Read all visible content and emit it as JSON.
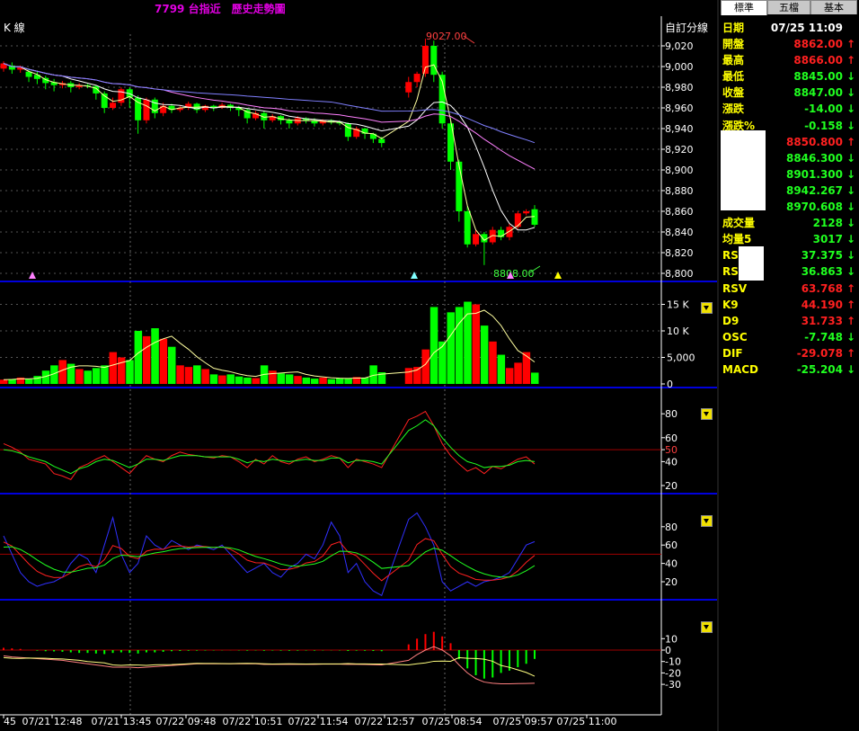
{
  "header": {
    "title": "7799 台指近　歷史走勢圖",
    "k_label": "K 線",
    "custom_label": "自訂分線"
  },
  "main_chart": {
    "y_ticks": [
      "9,020",
      "9,000",
      "8,980",
      "8,960",
      "8,940",
      "8,920",
      "8,900",
      "8,880",
      "8,860",
      "8,840",
      "8,820",
      "8,800"
    ],
    "high_label": "9027.00",
    "low_label": "8808.00"
  },
  "volume_chart": {
    "y_ticks": [
      "15 K",
      "10 K",
      "5,000",
      "0"
    ]
  },
  "rsi_chart": {
    "y_ticks": [
      "80",
      "60",
      "50",
      "40",
      "20"
    ]
  },
  "kd_chart": {
    "y_ticks": [
      "80",
      "60",
      "40",
      "20"
    ]
  },
  "macd_chart": {
    "y_ticks": [
      "10",
      "0",
      "-10",
      "-20",
      "-30"
    ]
  },
  "x_axis": {
    "labels": [
      "45",
      "07/21 12:48",
      "07/21 13:45",
      "07/22 09:48",
      "07/22 10:51",
      "07/22 11:54",
      "07/22 12:57",
      "07/25 08:54",
      "07/25 09:57",
      "07/25 11:00"
    ]
  },
  "colors": {
    "up": "#ff0000",
    "down": "#00ff00",
    "flat": "#ffffff",
    "label": "#ffff00",
    "axis_line": "#0000cc"
  },
  "panel": {
    "tabs": [
      "標準",
      "五檔",
      "基本"
    ],
    "rows": [
      {
        "label": "日期",
        "value": "07/25 11:09",
        "color": "#ffffff",
        "arrow": ""
      },
      {
        "label": "開盤",
        "value": "8862.00",
        "color": "#ff2020",
        "arrow": "↑"
      },
      {
        "label": "最高",
        "value": "8866.00",
        "color": "#ff2020",
        "arrow": "↑"
      },
      {
        "label": "最低",
        "value": "8845.00",
        "color": "#20ff20",
        "arrow": "↓"
      },
      {
        "label": "收盤",
        "value": "8847.00",
        "color": "#20ff20",
        "arrow": "↓"
      },
      {
        "label": "漲跌",
        "value": "-14.00",
        "color": "#20ff20",
        "arrow": "↓"
      },
      {
        "label": "漲跌%",
        "value": "-0.158",
        "color": "#20ff20",
        "arrow": "↓"
      },
      {
        "label": "",
        "value": "8850.800",
        "color": "#ff2020",
        "arrow": "↑"
      },
      {
        "label": "",
        "value": "8846.300",
        "color": "#20ff20",
        "arrow": "↓"
      },
      {
        "label": "",
        "value": "8901.300",
        "color": "#20ff20",
        "arrow": "↓"
      },
      {
        "label": "",
        "value": "8942.267",
        "color": "#20ff20",
        "arrow": "↓"
      },
      {
        "label": "",
        "value": "8970.608",
        "color": "#20ff20",
        "arrow": "↓"
      },
      {
        "label": "成交量",
        "value": "2128",
        "color": "#20ff20",
        "arrow": "↓"
      },
      {
        "label": "均量5",
        "value": "3017",
        "color": "#20ff20",
        "arrow": "↓"
      },
      {
        "label": "RSI",
        "value": "37.375",
        "color": "#20ff20",
        "arrow": "↓"
      },
      {
        "label": "RSI",
        "value": "36.863",
        "color": "#20ff20",
        "arrow": "↓"
      },
      {
        "label": "RSV",
        "value": "63.768",
        "color": "#ff2020",
        "arrow": "↑"
      },
      {
        "label": "K9",
        "value": "44.190",
        "color": "#ff2020",
        "arrow": "↑"
      },
      {
        "label": "D9",
        "value": "31.733",
        "color": "#ff2020",
        "arrow": "↑"
      },
      {
        "label": "OSC",
        "value": "-7.748",
        "color": "#20ff20",
        "arrow": "↓"
      },
      {
        "label": "DIF",
        "value": "-29.078",
        "color": "#ff2020",
        "arrow": "↑"
      },
      {
        "label": "MACD",
        "value": "-25.204",
        "color": "#20ff20",
        "arrow": "↓"
      }
    ]
  }
}
